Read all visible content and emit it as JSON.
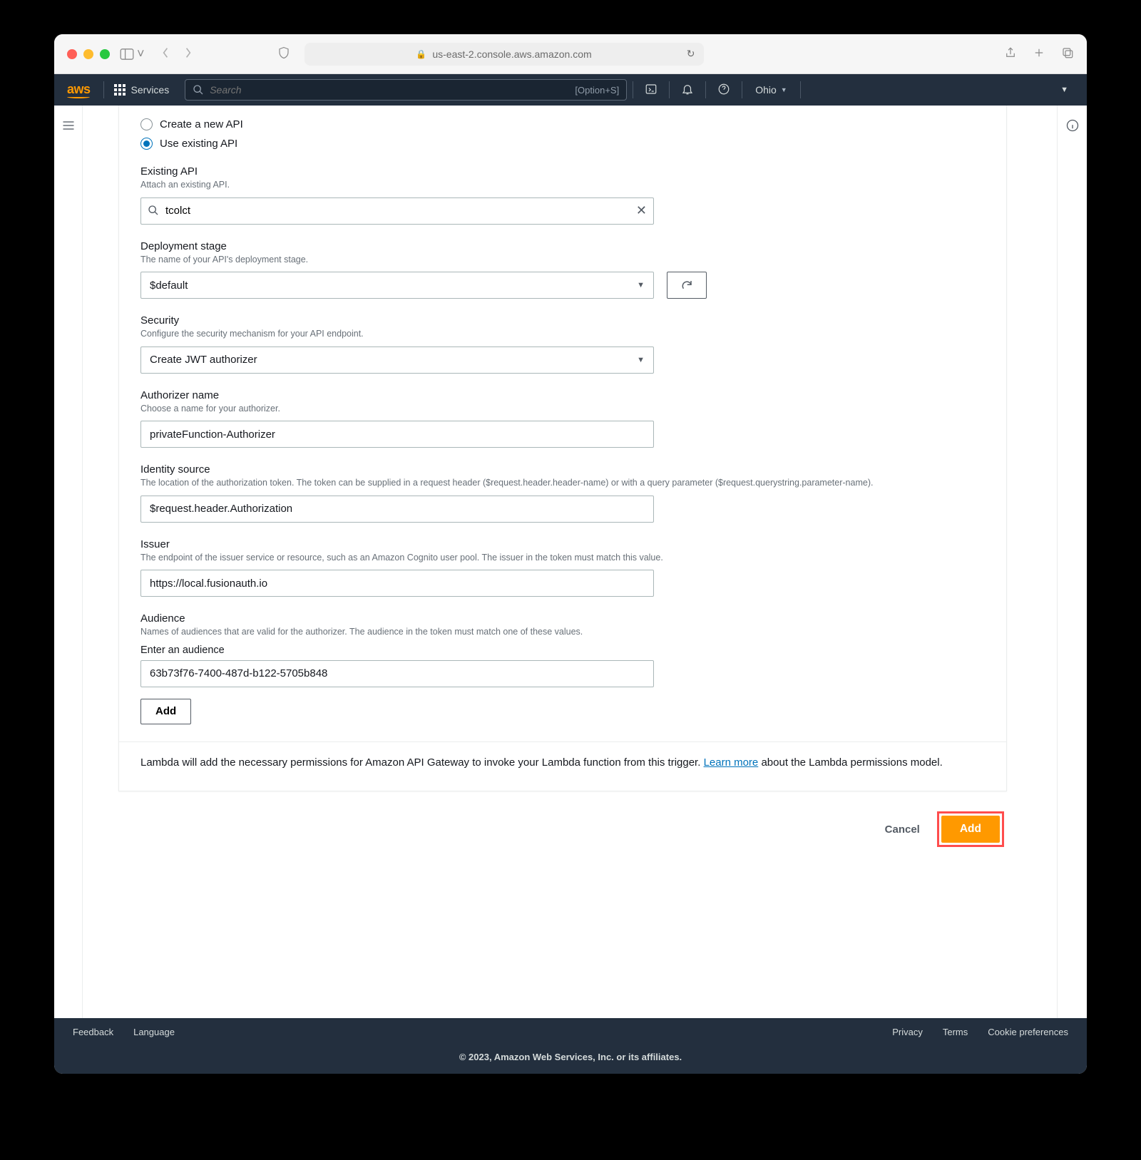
{
  "browser": {
    "url": "us-east-2.console.aws.amazon.com"
  },
  "nav": {
    "services": "Services",
    "search_placeholder": "Search",
    "search_kbd": "[Option+S]",
    "region": "Ohio"
  },
  "form": {
    "radio_create": "Create a new API",
    "radio_existing": "Use existing API",
    "existing_api": {
      "label": "Existing API",
      "desc": "Attach an existing API.",
      "value": "tcolct"
    },
    "stage": {
      "label": "Deployment stage",
      "desc": "The name of your API's deployment stage.",
      "value": "$default"
    },
    "security": {
      "label": "Security",
      "desc": "Configure the security mechanism for your API endpoint.",
      "value": "Create JWT authorizer"
    },
    "authorizer": {
      "label": "Authorizer name",
      "desc": "Choose a name for your authorizer.",
      "value": "privateFunction-Authorizer"
    },
    "identity": {
      "label": "Identity source",
      "desc": "The location of the authorization token. The token can be supplied in a request header ($request.header.header-name) or with a query parameter ($request.querystring.parameter-name).",
      "value": "$request.header.Authorization"
    },
    "issuer": {
      "label": "Issuer",
      "desc": "The endpoint of the issuer service or resource, such as an Amazon Cognito user pool. The issuer in the token must match this value.",
      "value": "https://local.fusionauth.io"
    },
    "audience": {
      "label": "Audience",
      "desc": "Names of audiences that are valid for the authorizer. The audience in the token must match one of these values.",
      "sub": "Enter an audience",
      "value": "63b73f76-7400-487d-b122-5705b848",
      "add_btn": "Add"
    },
    "note_text": "Lambda will add the necessary permissions for Amazon API Gateway to invoke your Lambda function from this trigger. ",
    "note_link": "Learn more",
    "note_suffix": " about the Lambda permissions model."
  },
  "actions": {
    "cancel": "Cancel",
    "add": "Add"
  },
  "footer": {
    "feedback": "Feedback",
    "language": "Language",
    "privacy": "Privacy",
    "terms": "Terms",
    "cookies": "Cookie preferences",
    "copyright": "© 2023, Amazon Web Services, Inc. or its affiliates."
  }
}
